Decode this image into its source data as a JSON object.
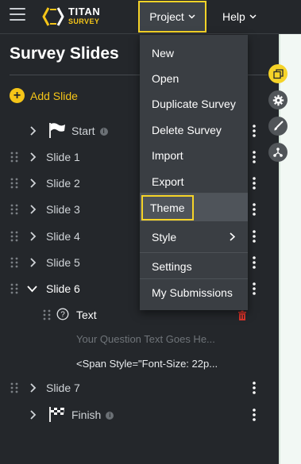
{
  "app": {
    "brand": "TITAN",
    "sub": "SURVEY"
  },
  "nav": {
    "project": "Project",
    "help": "Help"
  },
  "page": {
    "title": "Survey Slides",
    "add_slide": "Add Slide"
  },
  "slides": [
    {
      "label": "Start"
    },
    {
      "label": "Slide 1"
    },
    {
      "label": "Slide 2"
    },
    {
      "label": "Slide 3"
    },
    {
      "label": "Slide 4"
    },
    {
      "label": "Slide 5"
    },
    {
      "label": "Slide 6"
    },
    {
      "label": "Text"
    },
    {
      "label": "Slide 7"
    },
    {
      "label": "Finish"
    }
  ],
  "question": {
    "placeholder": "Your Question Text Goes He...",
    "markup": "<Span Style=\"Font-Size: 22p..."
  },
  "menu": {
    "items": [
      "New",
      "Open",
      "Duplicate Survey",
      "Delete Survey",
      "Import",
      "Export",
      "Theme",
      "Style",
      "Settings",
      "My Submissions"
    ]
  },
  "icons": {
    "right_rail": [
      "copy-icon",
      "gear-icon",
      "brush-icon",
      "share-icon"
    ]
  },
  "colors": {
    "accent": "#f5c518",
    "highlight": "#f5d328",
    "danger": "#d9342b"
  }
}
